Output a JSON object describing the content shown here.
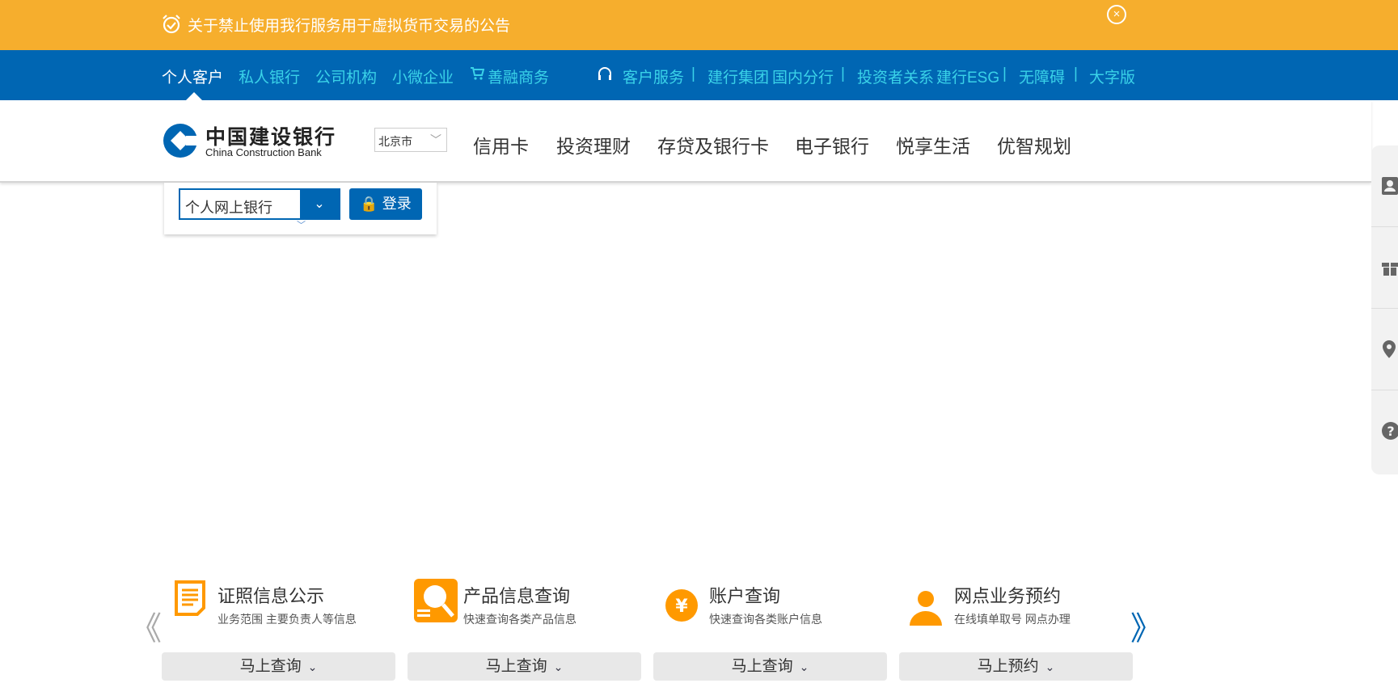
{
  "notice": {
    "text": "关于禁止使用我行服务用于虚拟货币交易的公告",
    "close": "×"
  },
  "topnav": {
    "left": [
      "个人客户",
      "私人银行",
      "公司机构",
      "小微企业",
      "善融商务"
    ],
    "right": [
      "客户服务",
      "建行集团",
      "国内分行",
      "投资者关系",
      "建行ESG",
      "无障碍",
      "大字版"
    ],
    "sep": "|"
  },
  "logo": {
    "cn": "中国建设银行",
    "en": "China Construction Bank"
  },
  "city": {
    "value": "北京市"
  },
  "mainnav": [
    "信用卡",
    "投资理财",
    "存贷及银行卡",
    "电子银行",
    "悦享生活",
    "优智规划"
  ],
  "login": {
    "select_value": "个人网上银行",
    "button": "登录"
  },
  "arrows": {
    "prev": "《",
    "next": "》"
  },
  "cards": [
    {
      "title": "证照信息公示",
      "sub": "业务范围 主要负责人等信息",
      "button": "马上查询"
    },
    {
      "title": "产品信息查询",
      "sub": "快速查询各类产品信息",
      "button": "马上查询"
    },
    {
      "title": "账户查询",
      "sub": "快速查询各类账户信息",
      "button": "马上查询"
    },
    {
      "title": "网点业务预约",
      "sub": "在线填单取号 网点办理",
      "button": "马上预约"
    }
  ],
  "colors": {
    "notice": "#f6ae2d",
    "brand": "#0066b3",
    "link": "#3ad2e8",
    "icon": "#ff9900"
  }
}
